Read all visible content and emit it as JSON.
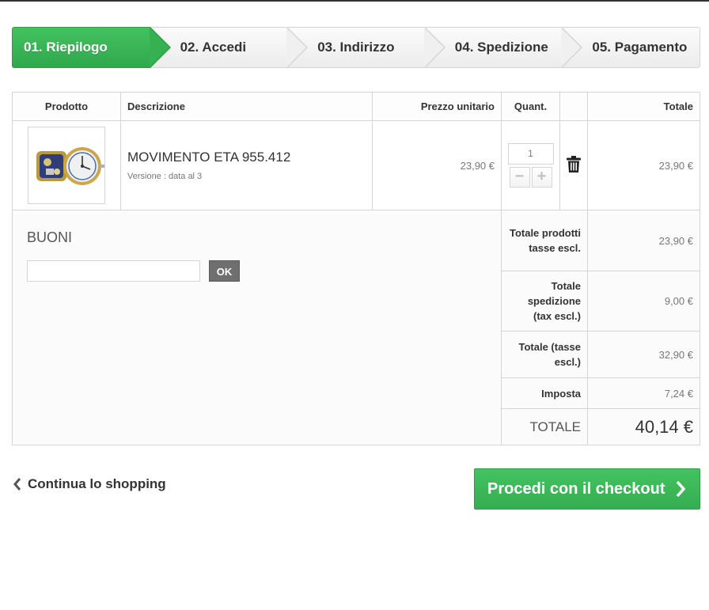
{
  "steps": [
    {
      "label": "01. Riepilogo",
      "active": true
    },
    {
      "label": "02. Accedi"
    },
    {
      "label": "03. Indirizzo"
    },
    {
      "label": "04. Spedizione"
    },
    {
      "label": "05. Pagamento"
    }
  ],
  "table": {
    "headers": {
      "product": "Prodotto",
      "description": "Descrizione",
      "unit_price": "Prezzo unitario",
      "quantity": "Quant.",
      "total": "Totale"
    },
    "item": {
      "name": "MOVIMENTO ETA 955.412",
      "variant": "Versione : data al 3",
      "unit_price": "23,90 €",
      "quantity": "1",
      "total": "23,90 €"
    }
  },
  "voucher": {
    "title": "BUONI",
    "input_value": "",
    "ok_label": "OK"
  },
  "summary": [
    {
      "label": "Totale prodotti tasse escl.",
      "value": "23,90 €"
    },
    {
      "label": "Totale spedizione (tax escl.)",
      "value": "9,00 €"
    },
    {
      "label": "Totale (tasse escl.)",
      "value": "32,90 €"
    },
    {
      "label": "Imposta",
      "value": "7,24 €"
    }
  ],
  "grand_total": {
    "label": "TOTALE",
    "value": "40,14 €"
  },
  "actions": {
    "continue_label": "Continua lo shopping",
    "checkout_label": "Procedi con il checkout"
  },
  "colors": {
    "accent_green": "#3aaa4f",
    "border": "#d6d4d4"
  }
}
